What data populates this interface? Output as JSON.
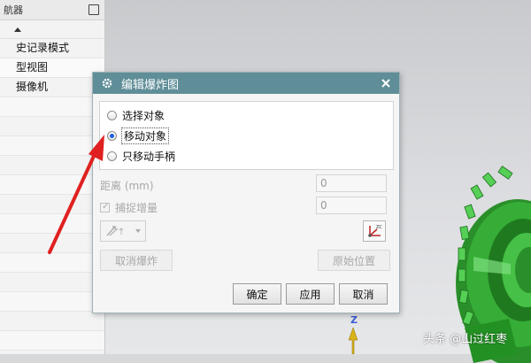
{
  "navigator": {
    "title": "航器",
    "items": [
      "史记录模式",
      "型视图",
      "摄像机"
    ]
  },
  "dialog": {
    "title": "编辑爆炸图",
    "options": [
      {
        "label": "选择对象",
        "selected": false
      },
      {
        "label": "移动对象",
        "selected": true
      },
      {
        "label": "只移动手柄",
        "selected": false
      }
    ],
    "distance_label": "距离 (mm)",
    "distance_value": "0",
    "snap_label": "捕捉增量",
    "snap_checked": true,
    "snap_value": "0",
    "cancel_explosion_label": "取消爆炸",
    "original_position_label": "原始位置",
    "ok_label": "确定",
    "apply_label": "应用",
    "cancel_label": "取消"
  },
  "viewport": {
    "axis_label": "Z"
  },
  "watermark": "头条 @山过红枣",
  "colors": {
    "titlebar": "#5f8e98",
    "gear_green": "#2fa02f",
    "annotation_arrow": "#e02020",
    "axis_blue": "#3c5bd0"
  }
}
